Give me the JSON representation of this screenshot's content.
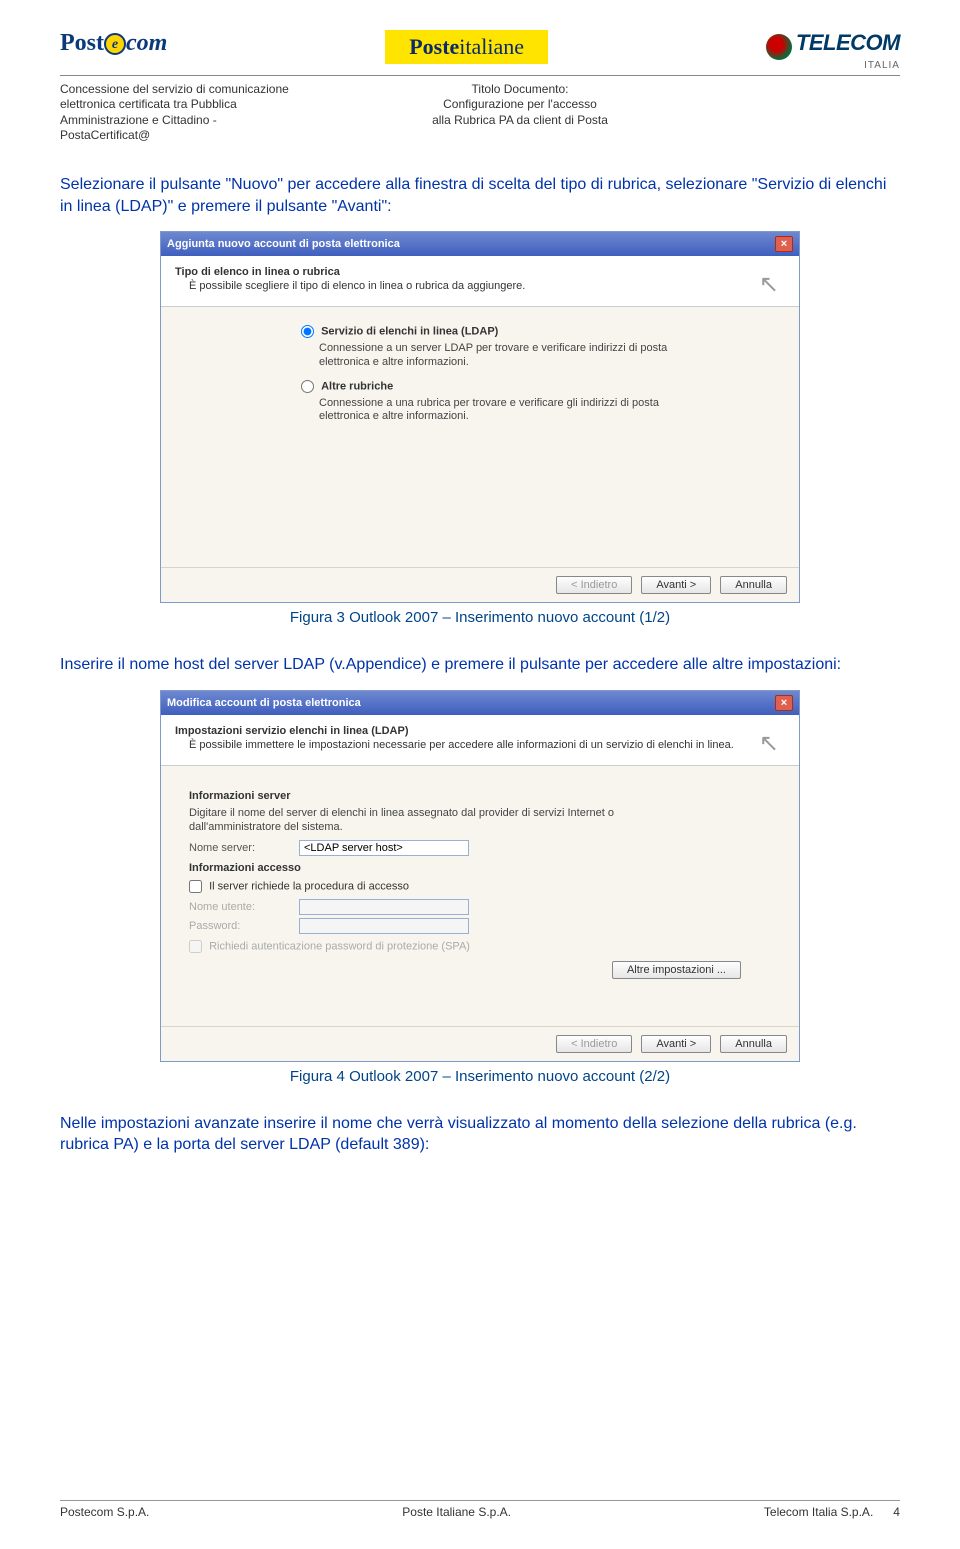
{
  "header": {
    "logo_postecom_prefix": "Post",
    "logo_postecom_e": "e",
    "logo_postecom_suffix": "com",
    "logo_posteitaliane_bold": "Poste",
    "logo_posteitaliane_rest": "italiane",
    "logo_telecom": "TELECOM",
    "logo_telecom_sub": "ITALIA"
  },
  "subheader": {
    "left": "Concessione del servizio di comunicazione elettronica certificata tra Pubblica Amministrazione e Cittadino - PostaCertificat@",
    "center_label": "Titolo Documento:",
    "center_line1": "Configurazione per l'accesso",
    "center_line2": "alla Rubrica PA da client di Posta"
  },
  "para1": "Selezionare il pulsante \"Nuovo\" per accedere alla finestra di scelta del tipo di rubrica, selezionare \"Servizio di elenchi in linea (LDAP)\" e premere il pulsante \"Avanti\":",
  "dialog1": {
    "title": "Aggiunta nuovo account di posta elettronica",
    "h4": "Tipo di elenco in linea o rubrica",
    "hdesc": "È possibile scegliere il tipo di elenco in linea o rubrica da aggiungere.",
    "radio1_label": "Servizio di elenchi in linea (LDAP)",
    "radio1_desc": "Connessione a un server LDAP per trovare e verificare indirizzi di posta elettronica e altre informazioni.",
    "radio2_label": "Altre rubriche",
    "radio2_desc": "Connessione a una rubrica per trovare e verificare gli indirizzi di posta elettronica e altre informazioni.",
    "btn_back": "< Indietro",
    "btn_next": "Avanti >",
    "btn_cancel": "Annulla"
  },
  "caption1": "Figura 3 Outlook 2007 – Inserimento nuovo account (1/2)",
  "para2": "Inserire il nome host del server LDAP (v.Appendice) e premere il pulsante per accedere alle altre impostazioni:",
  "dialog2": {
    "title": "Modifica account di posta elettronica",
    "h4": "Impostazioni servizio elenchi in linea (LDAP)",
    "hdesc": "È possibile immettere le impostazioni necessarie per accedere alle informazioni di un servizio di elenchi in linea.",
    "sec_server": "Informazioni server",
    "sec_server_desc": "Digitare il nome del server di elenchi in linea assegnato dal provider di servizi Internet o dall'amministratore del sistema.",
    "lbl_server": "Nome server:",
    "val_server": "<LDAP server host>",
    "sec_access": "Informazioni accesso",
    "chk_login": "Il server richiede la procedura di accesso",
    "lbl_user": "Nome utente:",
    "lbl_pass": "Password:",
    "chk_spa": "Richiedi autenticazione password di protezione (SPA)",
    "btn_more": "Altre impostazioni ...",
    "btn_back": "< Indietro",
    "btn_next": "Avanti >",
    "btn_cancel": "Annulla"
  },
  "caption2": "Figura 4 Outlook 2007 – Inserimento nuovo account (2/2)",
  "para3": "Nelle impostazioni avanzate inserire il nome che verrà visualizzato al momento della selezione della rubrica (e.g. rubrica PA) e la porta del server LDAP (default 389):",
  "footer": {
    "left": "Postecom S.p.A.",
    "center": "Poste Italiane S.p.A.",
    "right": "Telecom Italia S.p.A.",
    "page": "4"
  }
}
